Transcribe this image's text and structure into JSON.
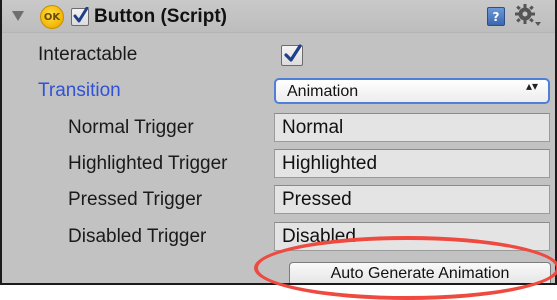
{
  "component": {
    "title": "Button (Script)",
    "ok_badge": "OK",
    "enabled": true,
    "help_glyph": "?",
    "icons": [
      "fold-arrow-icon",
      "ok-icon",
      "help-book-icon",
      "gear-icon"
    ]
  },
  "properties": {
    "interactable": {
      "label": "Interactable",
      "checked": true
    },
    "transition": {
      "label": "Transition",
      "selected": "Animation",
      "options_glyph": "▴▾"
    },
    "normal_trigger": {
      "label": "Normal Trigger",
      "value": "Normal"
    },
    "highlighted_trigger": {
      "label": "Highlighted Trigger",
      "value": "Highlighted"
    },
    "pressed_trigger": {
      "label": "Pressed Trigger",
      "value": "Pressed"
    },
    "disabled_trigger": {
      "label": "Disabled Trigger",
      "value": "Disabled"
    }
  },
  "actions": {
    "auto_generate_label": "Auto Generate Animation"
  },
  "colors": {
    "panel": "#c2c2c2",
    "label_accent": "#2f52d6",
    "dropdown_focus": "#4f7fd8",
    "annotation_ring": "#ee4a3f"
  }
}
